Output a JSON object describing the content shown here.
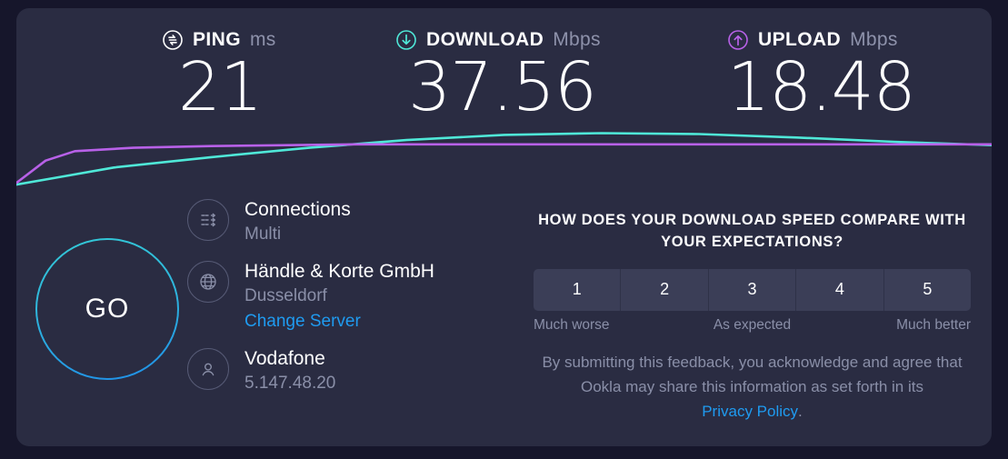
{
  "metrics": [
    {
      "icon": "ping-icon",
      "name": "PING",
      "unit": "ms",
      "value": "21",
      "color": "#ffffff"
    },
    {
      "icon": "download-icon",
      "name": "DOWNLOAD",
      "unit": "Mbps",
      "value": "37.56",
      "color": "#4fe8d8"
    },
    {
      "icon": "upload-icon",
      "name": "UPLOAD",
      "unit": "Mbps",
      "value": "18.48",
      "color": "#b861e8"
    }
  ],
  "go_button": {
    "label": "GO"
  },
  "connection": {
    "connections": {
      "icon": "connections-icon",
      "title": "Connections",
      "sub": "Multi"
    },
    "server": {
      "icon": "globe-icon",
      "title": "Händle & Korte GmbH",
      "sub": "Dusseldorf",
      "change_link": "Change Server"
    },
    "isp": {
      "icon": "person-icon",
      "title": "Vodafone",
      "sub": "5.147.48.20"
    }
  },
  "feedback": {
    "question": "HOW DOES YOUR DOWNLOAD SPEED COMPARE WITH YOUR EXPECTATIONS?",
    "ratings": [
      "1",
      "2",
      "3",
      "4",
      "5"
    ],
    "scale_low": "Much worse",
    "scale_mid": "As expected",
    "scale_high": "Much better",
    "disclaimer_before": "By submitting this feedback, you acknowledge and agree that Ookla may share this information as set forth in its ",
    "disclaimer_link": "Privacy Policy",
    "disclaimer_after": "."
  },
  "chart_data": {
    "type": "line",
    "title": "",
    "xlabel": "",
    "ylabel": "",
    "series": [
      {
        "name": "download",
        "color": "#4fe8d8",
        "x": [
          0,
          4,
          10,
          20,
          30,
          40,
          50,
          60,
          70,
          80,
          90,
          100
        ],
        "y": [
          2,
          10,
          22,
          34,
          45,
          54,
          60,
          62,
          61,
          57,
          52,
          48
        ]
      },
      {
        "name": "upload",
        "color": "#b861e8",
        "x": [
          0,
          3,
          6,
          12,
          20,
          35,
          50,
          70,
          85,
          100
        ],
        "y": [
          4,
          30,
          41,
          45,
          47,
          49,
          49,
          49,
          49,
          49
        ]
      }
    ]
  }
}
